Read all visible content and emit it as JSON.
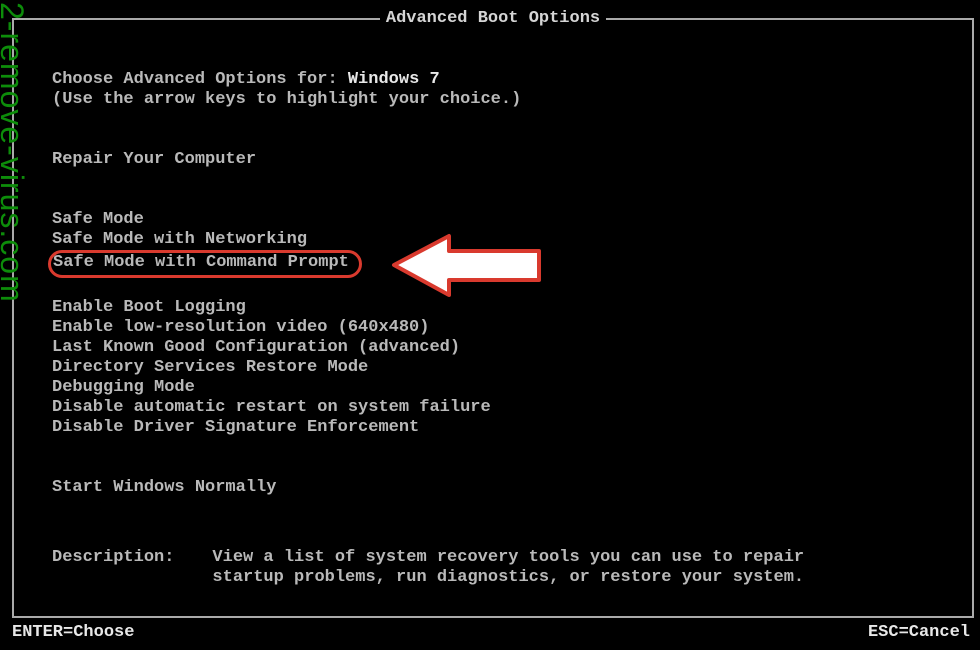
{
  "watermark": "2-remove-virus.com",
  "title": "Advanced Boot Options",
  "choose_prefix": "Choose Advanced Options for: ",
  "os_name": "Windows 7",
  "instruction": "(Use the arrow keys to highlight your choice.)",
  "repair": "Repair Your Computer",
  "options_group1": [
    "Safe Mode",
    "Safe Mode with Networking",
    "Safe Mode with Command Prompt"
  ],
  "options_group2": [
    "Enable Boot Logging",
    "Enable low-resolution video (640x480)",
    "Last Known Good Configuration (advanced)",
    "Directory Services Restore Mode",
    "Debugging Mode",
    "Disable automatic restart on system failure",
    "Disable Driver Signature Enforcement"
  ],
  "start_normal": "Start Windows Normally",
  "desc_label": "Description:",
  "desc_text": "View a list of system recovery tools you can use to repair startup problems, run diagnostics, or restore your system.",
  "footer_left": "ENTER=Choose",
  "footer_right": "ESC=Cancel",
  "colors": {
    "highlight_border": "#d93a2e",
    "text": "#b9b9b9",
    "watermark": "#0d8c0a",
    "arrow_fill": "#ffffff",
    "arrow_border": "#d93a2e"
  }
}
